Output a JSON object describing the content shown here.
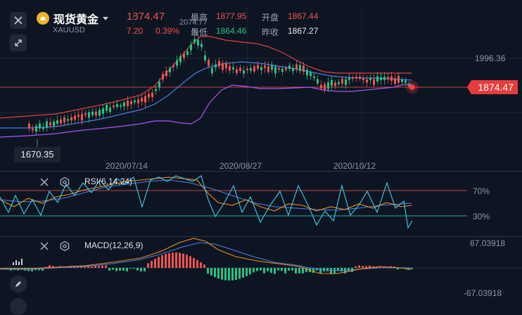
{
  "header": {
    "title": "现货黄金",
    "symbol": "XAUUSD",
    "last_price": "1874.47",
    "change": "7.20",
    "change_pct": "0.39%",
    "quote": {
      "high_label": "最高",
      "high_value": "1877.95",
      "open_label": "开盘",
      "open_value": "1867.44",
      "low_label": "最低",
      "low_value": "1864.46",
      "prev_close_label": "昨收",
      "prev_close_value": "1867.27"
    }
  },
  "main_chart": {
    "high_annotation": "2074.77",
    "low_annotation": "1670.35",
    "price_level_label": "1996.36",
    "current_price_tag": "1874.47",
    "dates": [
      "2020/07/14",
      "2020/08/27",
      "2020/10/12"
    ]
  },
  "rsi_panel": {
    "label": "RSI(6,14,24)",
    "level_high": "70%",
    "level_low": "30%"
  },
  "macd_panel": {
    "label": "MACD(12,26,9)",
    "scale_top": "67.03918",
    "scale_bottom": "-67.03918"
  },
  "colors": {
    "background": "#0e1522",
    "up": "#ef5350",
    "down": "#26c281",
    "ma_blue": "#4a7fe0",
    "band_purple": "#a855f7",
    "band_red": "#e04040",
    "rsi_cyan": "#3ad0e8"
  },
  "icons": {
    "close": "close-icon",
    "expand": "expand-arrows-icon",
    "settings": "gear-icon",
    "edit": "pencil-icon",
    "symbol_logo": "gold-bar-icon",
    "dropdown": "caret-down-icon"
  }
}
